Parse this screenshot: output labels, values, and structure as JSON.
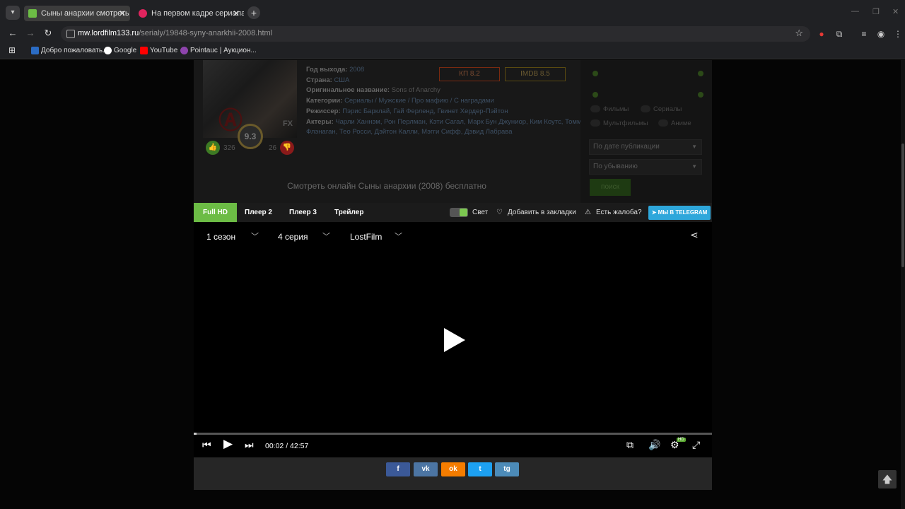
{
  "browser": {
    "tabs": [
      {
        "title": "Сыны анархии смотреть онлайн",
        "favicon_color": "#6cbc45"
      },
      {
        "title": "На первом кадре сериала Go...",
        "favicon_color": "#e0245e"
      }
    ],
    "new_tab": "+",
    "url_host": "mw.lordfilm133.ru",
    "url_path": "/serialy/19848-syny-anarkhii-2008.html",
    "bookmarks": [
      {
        "label": "Добро пожаловать...",
        "color": "#2b6cc4"
      },
      {
        "label": "Google",
        "color": "#ffffff"
      },
      {
        "label": "YouTube",
        "color": "#ff0000"
      },
      {
        "label": "Pointauc | Аукцион...",
        "color": "#8e44ad"
      }
    ]
  },
  "movie": {
    "rating": "9.3",
    "likes": "326",
    "dislikes": "26",
    "year_label": "Год выхода:",
    "year": "2008",
    "country_label": "Страна:",
    "country": "США",
    "orig_label": "Оригинальное название:",
    "orig": "Sons of Anarchy",
    "cat_label": "Категории:",
    "categories": "Сериалы / Мужские / Про мафию / С наградами",
    "dir_label": "Режиссер:",
    "directors": "Пэрис Барклай, Гай Ферленд, Гвинет Хердер-Пэйтон",
    "actors_label": "Актеры:",
    "actors_1": "Чарли Ханнэм, Рон Перлман, Кэти Сагал, Марк Бун Джуниор, Ким Коутс, Томми",
    "actors_2": "Флэнаган, Тео Росси, Дэйтон Калли, Мэгги Сифф, Дэвид Лабрава",
    "kp": "КП 8.2",
    "imdb": "IMDB 8.5",
    "subtitle": "Смотреть онлайн Сыны анархии (2008) бесплатно"
  },
  "filters": {
    "films": "Фильмы",
    "serials": "Сериалы",
    "cartoons": "Мультфильмы",
    "anime": "Аниме",
    "sort1": "По дате публикации",
    "sort2": "По убыванию",
    "search": "поиск"
  },
  "player": {
    "tabs": [
      "Full HD",
      "Плеер 2",
      "Плеер 3",
      "Трейлер"
    ],
    "light": "Свет",
    "bookmark": "Добавить в закладки",
    "complain": "Есть жалоба?",
    "telegram": "МЫ В TELEGRAM",
    "season": "1 сезон",
    "episode": "4 серия",
    "voice": "LostFilm",
    "time": "00:02 / 42:57",
    "progress": 0.001,
    "quality_badge": "HD"
  },
  "share": [
    {
      "label": "f",
      "color": "#3b5998"
    },
    {
      "label": "vk",
      "color": "#4c75a3"
    },
    {
      "label": "ok",
      "color": "#f57d00"
    },
    {
      "label": "t",
      "color": "#1da1f2"
    },
    {
      "label": "tg",
      "color": "#4c8bb8"
    }
  ]
}
